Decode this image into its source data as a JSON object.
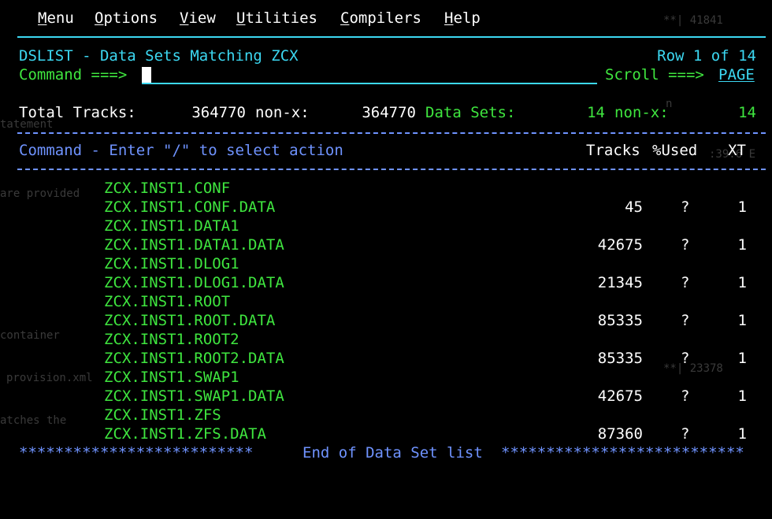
{
  "menu": [
    "Menu",
    "Options",
    "View",
    "Utilities",
    "Compilers",
    "Help"
  ],
  "background_text": {
    "a": "**| 41841",
    "b": "**| 23378",
    "c": "are provided",
    "d": "container",
    "e": "provision.xml",
    "f": "atches the",
    "g": ":39:6 E",
    "h": "n",
    "i": "tatement"
  },
  "header": {
    "title": "DSLIST - Data Sets Matching ZCX",
    "row_info": "Row 1 of 14",
    "command_label": "Command ===>",
    "command_value": "",
    "scroll_label": "Scroll ===>",
    "scroll_value": "PAGE"
  },
  "totals": {
    "tracks_label": "Total Tracks:",
    "tracks": "364770",
    "nonx_label": "non-x:",
    "tracks_nonx": "364770",
    "datasets_label": "Data Sets:",
    "datasets": "14",
    "datasets_nonx_label": "non-x:",
    "datasets_nonx": "14"
  },
  "columns": {
    "command_hint": "Command - Enter \"/\" to select action",
    "tracks": "Tracks",
    "used": "%Used",
    "xt": "XT"
  },
  "datasets": [
    {
      "name": "ZCX.INST1.CONF",
      "tracks": "",
      "used": "",
      "xt": ""
    },
    {
      "name": "ZCX.INST1.CONF.DATA",
      "tracks": "45",
      "used": "?",
      "xt": "1"
    },
    {
      "name": "ZCX.INST1.DATA1",
      "tracks": "",
      "used": "",
      "xt": ""
    },
    {
      "name": "ZCX.INST1.DATA1.DATA",
      "tracks": "42675",
      "used": "?",
      "xt": "1"
    },
    {
      "name": "ZCX.INST1.DLOG1",
      "tracks": "",
      "used": "",
      "xt": ""
    },
    {
      "name": "ZCX.INST1.DLOG1.DATA",
      "tracks": "21345",
      "used": "?",
      "xt": "1"
    },
    {
      "name": "ZCX.INST1.ROOT",
      "tracks": "",
      "used": "",
      "xt": ""
    },
    {
      "name": "ZCX.INST1.ROOT.DATA",
      "tracks": "85335",
      "used": "?",
      "xt": "1"
    },
    {
      "name": "ZCX.INST1.ROOT2",
      "tracks": "",
      "used": "",
      "xt": ""
    },
    {
      "name": "ZCX.INST1.ROOT2.DATA",
      "tracks": "85335",
      "used": "?",
      "xt": "1"
    },
    {
      "name": "ZCX.INST1.SWAP1",
      "tracks": "",
      "used": "",
      "xt": ""
    },
    {
      "name": "ZCX.INST1.SWAP1.DATA",
      "tracks": "42675",
      "used": "?",
      "xt": "1"
    },
    {
      "name": "ZCX.INST1.ZFS",
      "tracks": "",
      "used": "",
      "xt": ""
    },
    {
      "name": "ZCX.INST1.ZFS.DATA",
      "tracks": "87360",
      "used": "?",
      "xt": "1"
    }
  ],
  "footer": {
    "stars_left": "**************************",
    "text": "End of Data Set list",
    "stars_right": "***************************"
  },
  "colors": {
    "background": "#000000",
    "cyan": "#3cd8f2",
    "green": "#3fe63f",
    "blue": "#6f93ff",
    "white": "#ffffff"
  }
}
